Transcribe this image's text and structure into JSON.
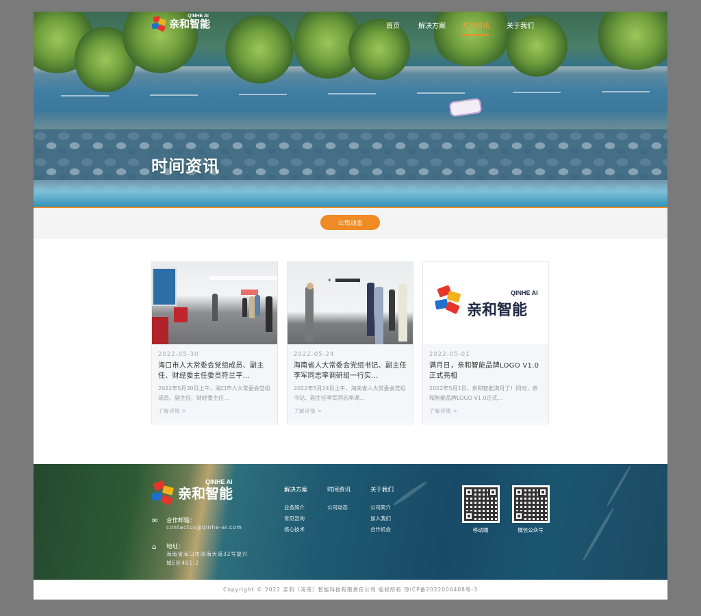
{
  "brand": {
    "name": "亲和智能",
    "sub": "QINHE AI",
    "colors": {
      "accent": "#f08a24",
      "red": "#e8352c",
      "blue": "#1e6fd0",
      "yellow": "#f2b21b",
      "navy": "#1f2a44"
    }
  },
  "nav": {
    "items": [
      {
        "label": "首页",
        "active": false
      },
      {
        "label": "解决方案",
        "active": false
      },
      {
        "label": "时间资讯",
        "active": true
      },
      {
        "label": "关于我们",
        "active": false
      }
    ]
  },
  "hero": {
    "title": "时间资讯"
  },
  "filter": {
    "label": "公司动态"
  },
  "cards": [
    {
      "date": "2022-05-30",
      "title": "海口市人大常委会党组成员、副主任、财经委主任委员符兰平...",
      "excerpt": "2022年5月30日上午，海口市人大常委会党组成员、副主任、财经委主任...",
      "more": "了解详情 >"
    },
    {
      "date": "2022-05-24",
      "title": "海南省人大常委会党组书记、副主任李军同志率调研组一行实...",
      "excerpt": "2022年5月24日上午，海南省人大常委会党组书记、副主任李军同志率调...",
      "more": "了解详情 >"
    },
    {
      "date": "2022-05-01",
      "title": "满月日，亲和智能品牌LOGO V1.0正式亮相",
      "excerpt": "2022年5月1日，亲和智能满月了！同时，亲和智能品牌LOGO V1.0正式...",
      "more": "了解详情 >"
    }
  ],
  "footer": {
    "contact": {
      "email_label": "合作邮箱：",
      "email": "contactus@qinhe-ai.com",
      "address_label": "地址：",
      "address_line1": "海南省海口市滨海大道32号复兴",
      "address_line2": "城E区401-2"
    },
    "columns": [
      {
        "title": "解决方案",
        "links": [
          "业务简介",
          "常见咨询",
          "核心技术"
        ]
      },
      {
        "title": "时间资讯",
        "links": [
          "公司动态"
        ]
      },
      {
        "title": "关于我们",
        "links": [
          "公司简介",
          "加入我们",
          "合作机会"
        ]
      }
    ],
    "qr": [
      {
        "caption": "移动端"
      },
      {
        "caption": "微信公众号"
      }
    ],
    "copyright": "Copyright © 2022 亲和（海南）智能科技有限责任公司 版权所有 琼ICP备2022006408号-3"
  },
  "icons": {
    "mail": "mail-icon",
    "location": "location-icon",
    "arrow": "chevron-right-icon"
  }
}
